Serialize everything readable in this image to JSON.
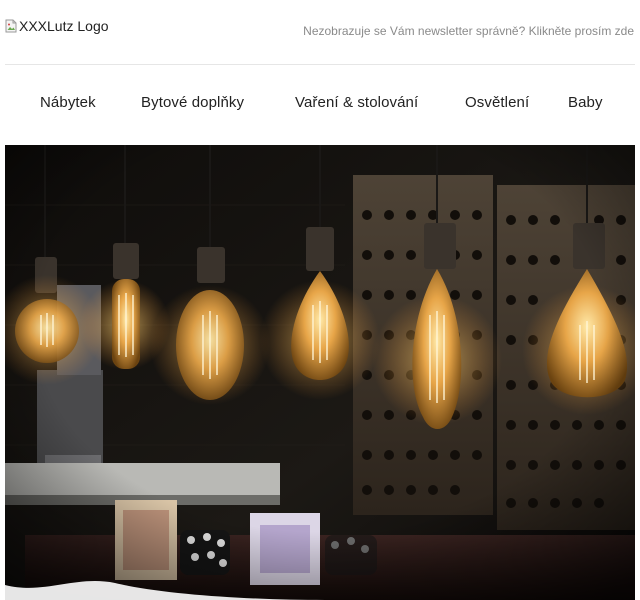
{
  "header": {
    "logo_alt": "XXXLutz Logo",
    "logo_icon": "broken-image-icon",
    "view_online": "Nezobrazuje se Vám newsletter správně? Klikněte prosím zde"
  },
  "nav": {
    "items": [
      {
        "label": "Nábytek"
      },
      {
        "label": "Bytové doplňky"
      },
      {
        "label": "Vaření & stolování"
      },
      {
        "label": "Osvětlení"
      },
      {
        "label": "Baby"
      }
    ]
  },
  "hero": {
    "description": "Industrial style hanging Edison bulbs in a dark interior",
    "colors": {
      "background": "#0c0a08",
      "glow": "#ffc766",
      "wood": "#6b5a48"
    }
  }
}
